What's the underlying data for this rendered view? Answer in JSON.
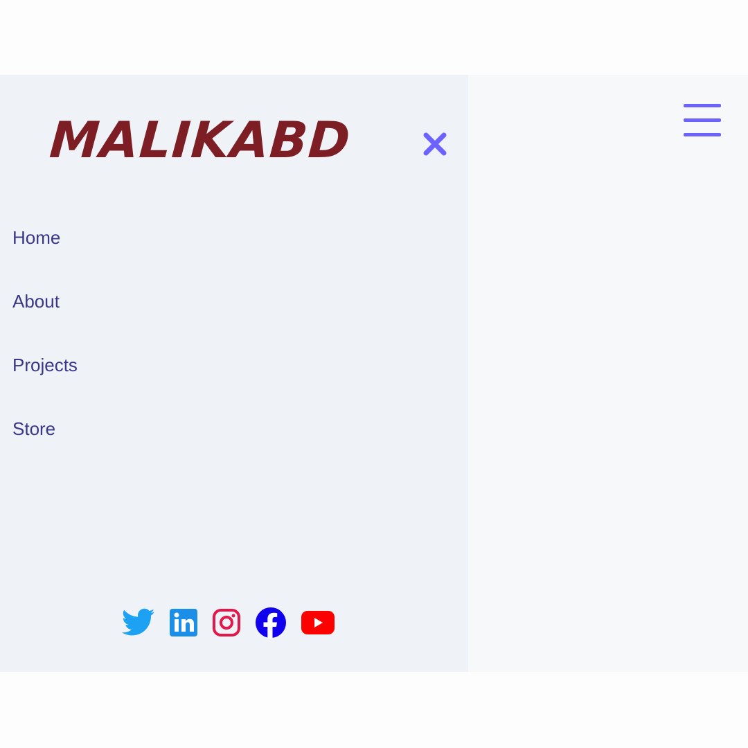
{
  "brand": {
    "logo_text": "MALIKABD"
  },
  "colors": {
    "accent": "#6c63ff",
    "logo": "#7d1d24",
    "nav_text": "#3a3688",
    "drawer_bg": "#eff3f8",
    "twitter": "#1da1f2",
    "linkedin": "#1b8fe8",
    "instagram": "#e4174a",
    "facebook": "#1000ee",
    "youtube": "#ff0000"
  },
  "drawer": {
    "close_icon": "close-icon",
    "nav_items": [
      {
        "label": "Home"
      },
      {
        "label": "About"
      },
      {
        "label": "Projects"
      },
      {
        "label": "Store"
      }
    ],
    "social_icons": [
      "twitter-icon",
      "linkedin-icon",
      "instagram-icon",
      "facebook-icon",
      "youtube-icon"
    ]
  },
  "header": {
    "menu_icon": "hamburger-menu-icon"
  }
}
